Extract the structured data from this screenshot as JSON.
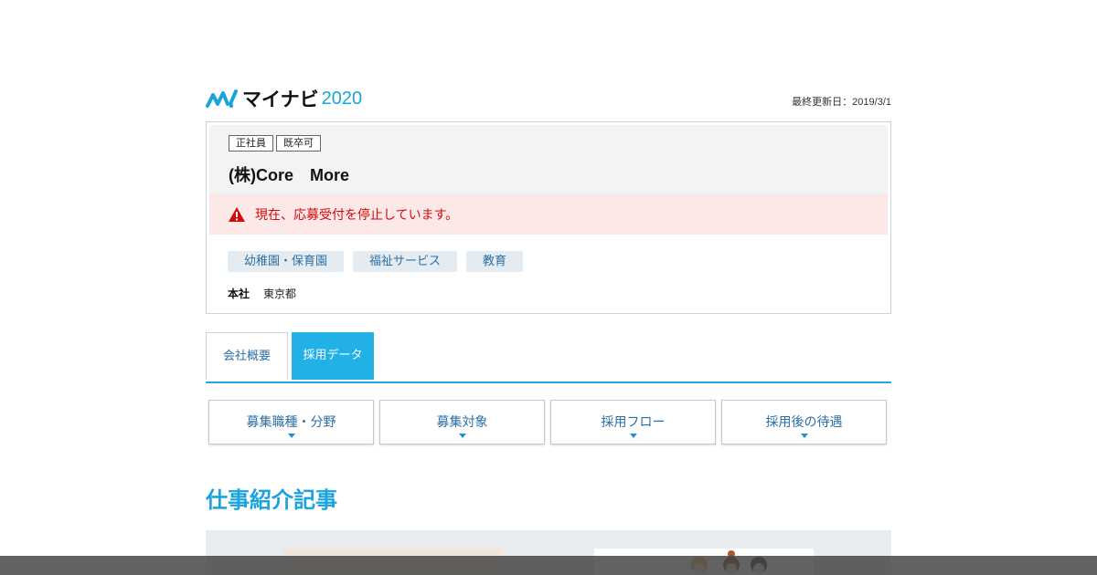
{
  "header": {
    "brand_name": "マイナビ",
    "brand_year": "2020",
    "updated": "最終更新日：2019/3/1"
  },
  "company": {
    "tags": [
      "正社員",
      "既卒可"
    ],
    "name": "(株)Core　More",
    "alert": "現在、応募受付を停止しています。",
    "industries": [
      "幼稚園・保育園",
      "福祉サービス",
      "教育"
    ],
    "location_label": "本社",
    "location_value": "東京都"
  },
  "tabs": {
    "overview": "会社概要",
    "recruit": "採用データ"
  },
  "sections": [
    "募集職種・分野",
    "募集対象",
    "採用フロー",
    "採用後の待遇"
  ],
  "articles": {
    "heading": "仕事紹介記事"
  },
  "colors": {
    "accent": "#1aa3dc",
    "active_tab": "#22b1e6",
    "alert_bg": "#fde8e8",
    "alert_text": "#d10a0a"
  }
}
